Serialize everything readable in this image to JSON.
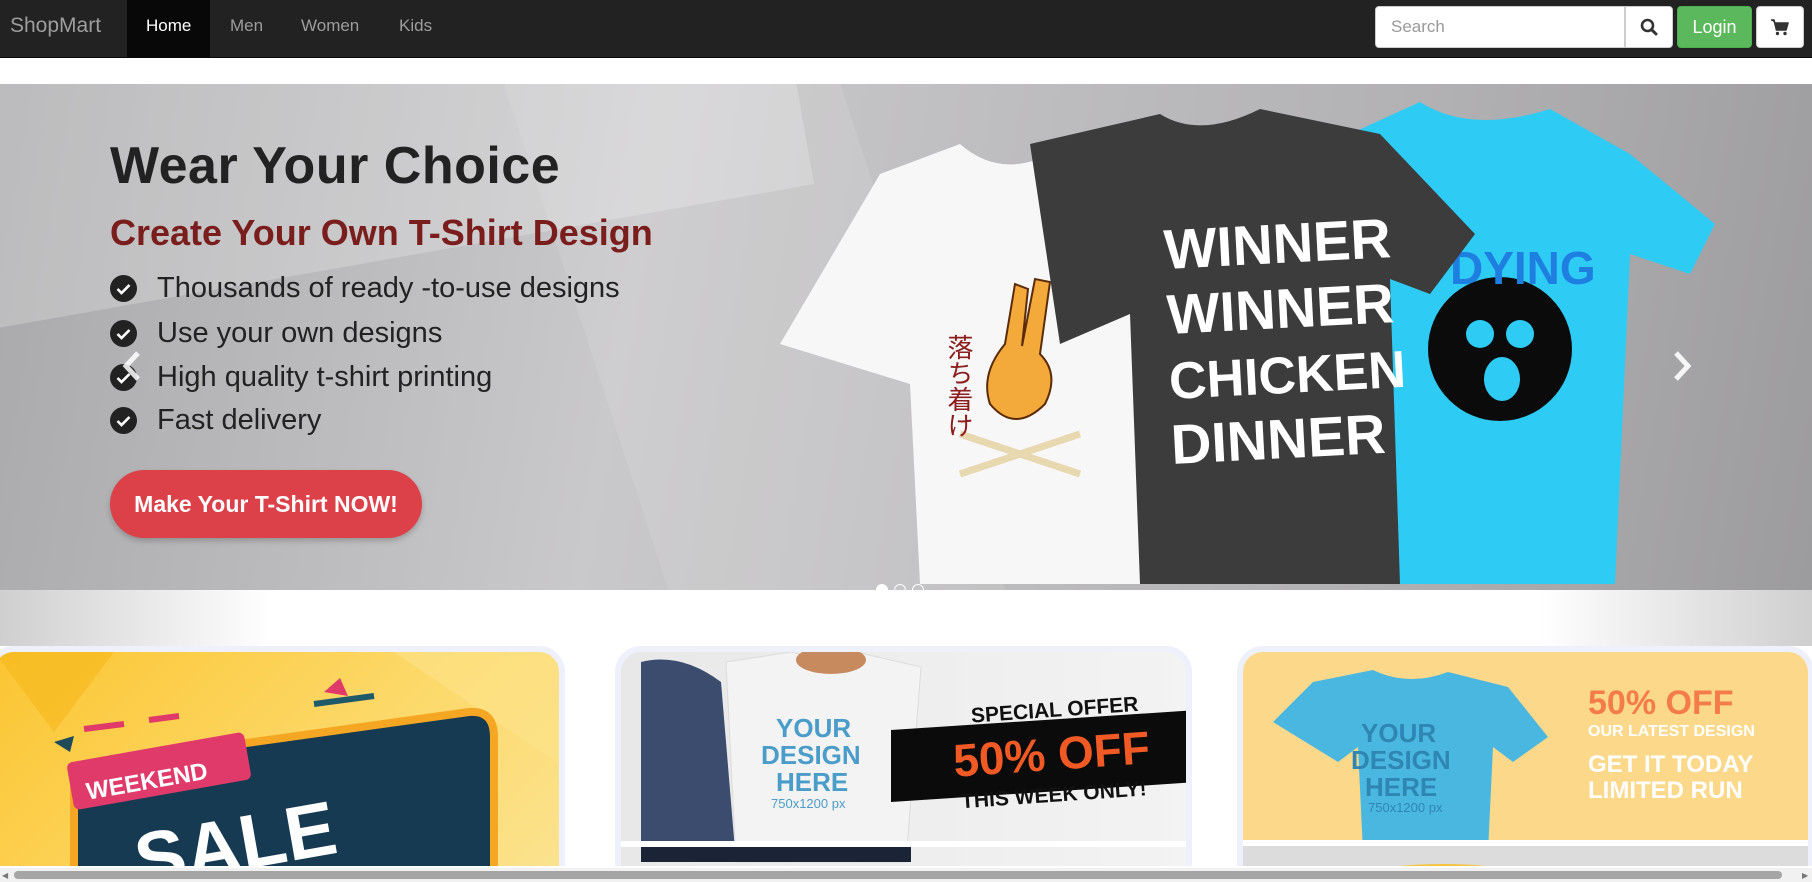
{
  "navbar": {
    "brand": "ShopMart",
    "items": [
      {
        "label": "Home",
        "active": true
      },
      {
        "label": "Men",
        "active": false
      },
      {
        "label": "Women",
        "active": false
      },
      {
        "label": "Kids",
        "active": false
      }
    ],
    "search_placeholder": "Search",
    "login_label": "Login",
    "search_icon": "search-icon",
    "cart_icon": "cart-icon"
  },
  "hero": {
    "title": "Wear Your Choice",
    "subtitle": "Create Your Own T-Shirt Design",
    "features": [
      "Thousands of ready -to-use designs",
      "Use your own designs",
      "High quality t-shirt printing",
      "Fast delivery"
    ],
    "cta_label": "Make Your T-Shirt NOW!",
    "tshirts": {
      "middle": [
        "WINNER",
        "WINNER",
        "CHICKEN",
        "DINNER"
      ],
      "right": "DYING",
      "left_text": "落ち着け"
    },
    "slides_total": 3,
    "active_slide": 1
  },
  "promos": {
    "weekend": {
      "tag": "WEEKEND",
      "headline": "SALE"
    },
    "special": {
      "line1": "SPECIAL OFFER",
      "line2": "50% OFF",
      "line3": "THIS WEEK ONLY!",
      "mockup_1": "YOUR",
      "mockup_2": "DESIGN",
      "mockup_3": "HERE",
      "mockup_4": "750x1200 px"
    },
    "latest": {
      "line1": "50% OFF",
      "line2": "OUR LATEST DESIGN",
      "line3": "GET IT TODAY",
      "line4": "LIMITED RUN",
      "mockup_1": "YOUR",
      "mockup_2": "DESIGN",
      "mockup_3": "HERE",
      "mockup_4": "750x1200 px"
    }
  },
  "colors": {
    "navbar_bg": "#222222",
    "login_green": "#5cb85c",
    "cta_red": "#dc4049",
    "subtitle_red": "#7a1d1d",
    "tee_blue": "#2ecbf5"
  }
}
